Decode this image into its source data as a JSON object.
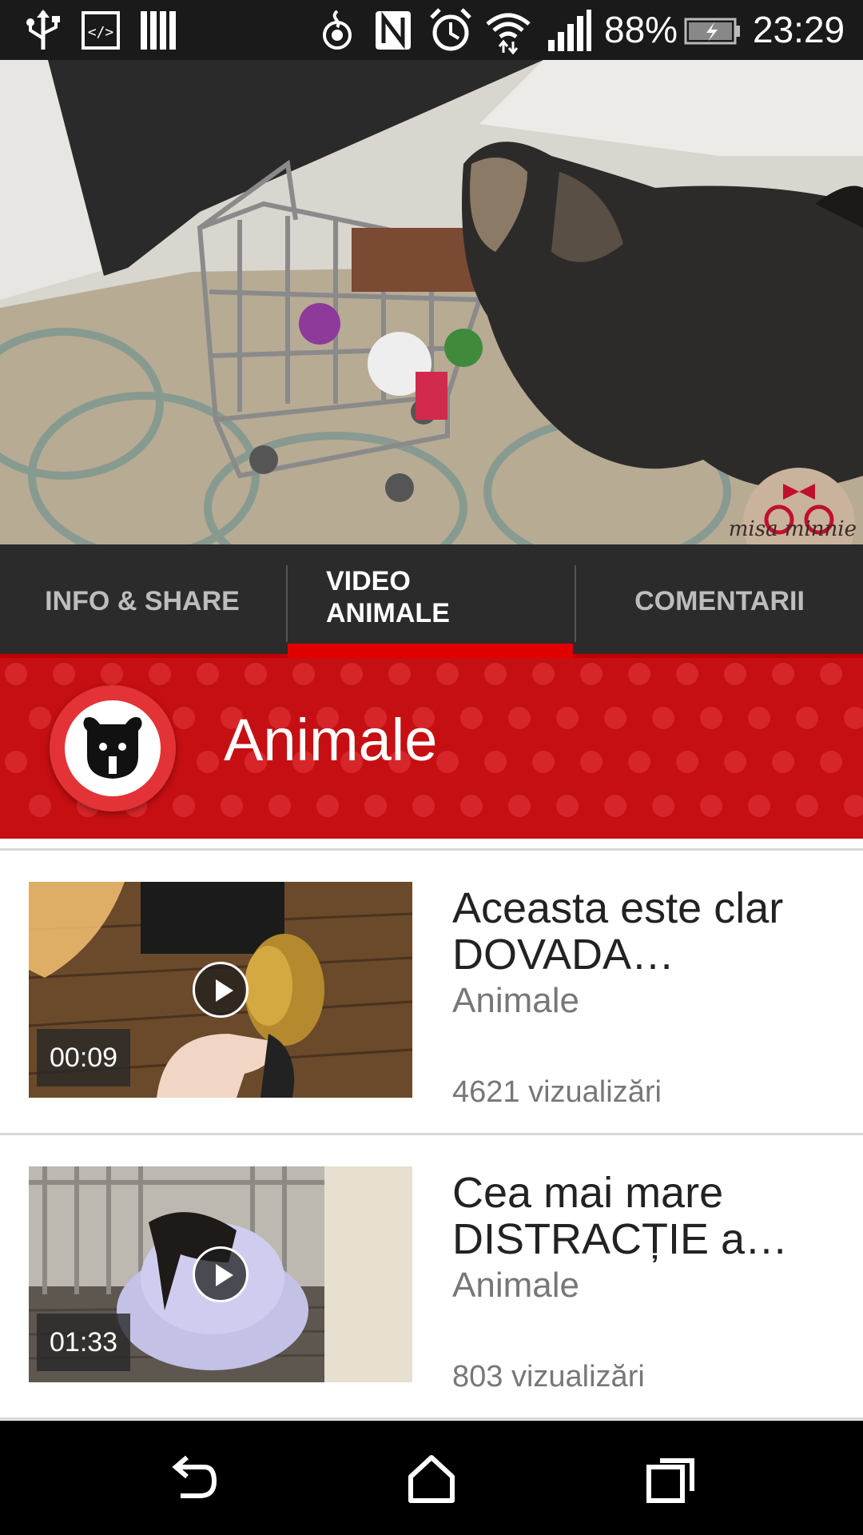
{
  "status_bar": {
    "battery": "88%",
    "time": "23:29",
    "icons": [
      "usb-icon",
      "developer-icon",
      "barcode-icon",
      "hotspot-icon",
      "nfc-icon",
      "alarm-icon",
      "wifi-icon",
      "signal-icon",
      "battery-charging-icon"
    ]
  },
  "player": {
    "watermark": "misa minnie"
  },
  "tabs": [
    {
      "label": "INFO & SHARE",
      "active": false
    },
    {
      "label": "VIDEO ANIMALE",
      "active": true
    },
    {
      "label": "COMENTARII",
      "active": false
    }
  ],
  "channel": {
    "name": "Animale",
    "accent_color": "#c50f12"
  },
  "videos": [
    {
      "title": "Aceasta este clar DOVADA…",
      "channel": "Animale",
      "views": "4621 vizualizări",
      "duration": "00:09"
    },
    {
      "title": "Cea mai mare DISTRACȚIE a…",
      "channel": "Animale",
      "views": "803 vizualizări",
      "duration": "01:33"
    }
  ],
  "nav_bar": {
    "icons": [
      "back-icon",
      "home-icon",
      "recents-icon"
    ]
  }
}
